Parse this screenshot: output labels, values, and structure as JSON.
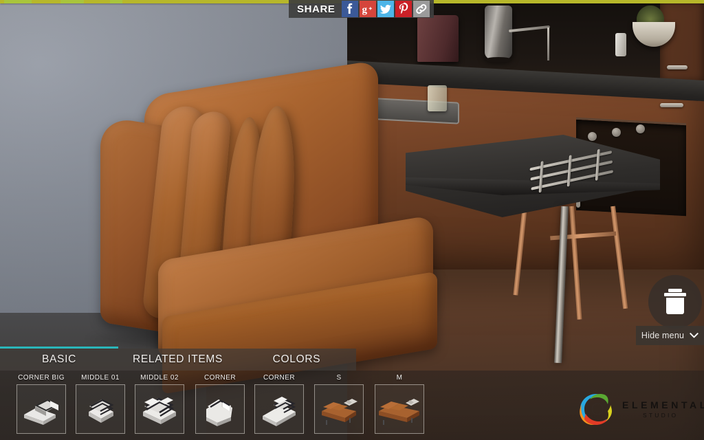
{
  "share": {
    "label": "SHARE",
    "items": [
      {
        "name": "facebook-share-icon",
        "glyph": "f",
        "color": "#3b5998"
      },
      {
        "name": "google-plus-share-icon",
        "glyph": "g+",
        "color": "#d5453b"
      },
      {
        "name": "twitter-share-icon",
        "glyph": "bird",
        "color": "#4db5e8"
      },
      {
        "name": "pinterest-share-icon",
        "glyph": "p",
        "color": "#cb2027"
      },
      {
        "name": "copy-link-icon",
        "glyph": "link",
        "color": "#9b9b9b"
      }
    ]
  },
  "controls": {
    "delete_label": "delete-button",
    "hide_menu_label": "Hide menu"
  },
  "tabs": [
    {
      "label": "BASIC",
      "active": true
    },
    {
      "label": "RELATED ITEMS",
      "active": false
    },
    {
      "label": "COLORS",
      "active": false
    }
  ],
  "accent_color": "#2ab6ba",
  "progress_color": "#b7b72a",
  "modules": [
    {
      "label": "CORNER BIG",
      "kind": "corner-big"
    },
    {
      "label": "MIDDLE 01",
      "kind": "middle-01"
    },
    {
      "label": "MIDDLE 02",
      "kind": "middle-02"
    },
    {
      "label": "CORNER",
      "kind": "corner-a"
    },
    {
      "label": "CORNER",
      "kind": "corner-b"
    },
    {
      "label": "S",
      "kind": "sofa-s"
    },
    {
      "label": "M",
      "kind": "sofa-m"
    }
  ],
  "brand": {
    "name": "ELEMENTALS",
    "sub": "STUDIO",
    "colors": [
      "#29a8df",
      "#5aa832",
      "#f0901e",
      "#e23b26",
      "#d9d21e"
    ]
  },
  "scene": {
    "product": "leather sectional sofa",
    "leather_color": "#a8652f",
    "wall_color": "#8f95a0",
    "floor_color": "#5b3b29"
  }
}
